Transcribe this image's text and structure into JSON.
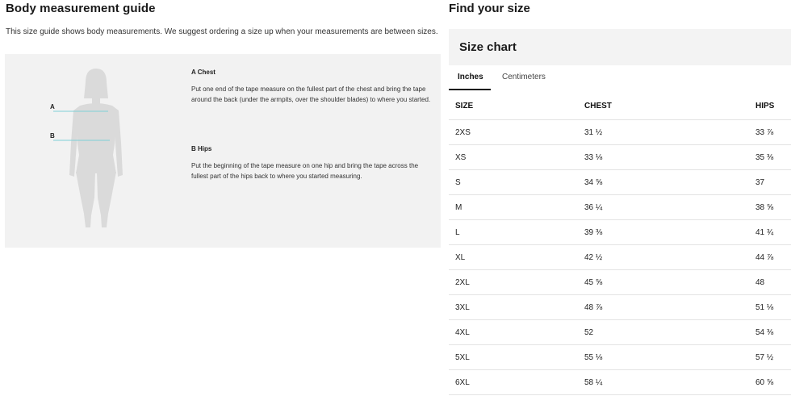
{
  "left": {
    "title": "Body measurement guide",
    "subtitle": "This size guide shows body measurements. We suggest ordering a size up when your measurements are between sizes.",
    "markers": {
      "a": "A",
      "b": "B"
    },
    "sections": [
      {
        "title": "A Chest",
        "text": "Put one end of the tape measure on the fullest part of the chest and bring the tape around the back (under the armpits, over the shoulder blades) to where you started."
      },
      {
        "title": "B Hips",
        "text": "Put the beginning of the tape measure on one hip and bring the tape across the fullest part of the hips back to where you started measuring."
      }
    ]
  },
  "right": {
    "title": "Find your size",
    "chart_title": "Size chart",
    "tabs": [
      {
        "label": "Inches",
        "active": true
      },
      {
        "label": "Centimeters",
        "active": false
      }
    ],
    "columns": [
      "SIZE",
      "CHEST",
      "HIPS"
    ],
    "rows": [
      [
        "2XS",
        "31 ½",
        "33 ⅞"
      ],
      [
        "XS",
        "33 ⅛",
        "35 ⅜"
      ],
      [
        "S",
        "34 ⅝",
        "37"
      ],
      [
        "M",
        "36 ¼",
        "38 ⅝"
      ],
      [
        "L",
        "39 ⅜",
        "41 ¾"
      ],
      [
        "XL",
        "42 ½",
        "44 ⅞"
      ],
      [
        "2XL",
        "45 ⅝",
        "48"
      ],
      [
        "3XL",
        "48 ⅞",
        "51 ⅛"
      ],
      [
        "4XL",
        "52",
        "54 ⅜"
      ],
      [
        "5XL",
        "55 ⅛",
        "57 ½"
      ],
      [
        "6XL",
        "58 ¼",
        "60 ⅝"
      ]
    ]
  },
  "colors": {
    "panel_bg": "#f2f2f2",
    "figure": "#dadada",
    "measure_line": "#7fd0d6",
    "text": "#1a1a1a"
  }
}
